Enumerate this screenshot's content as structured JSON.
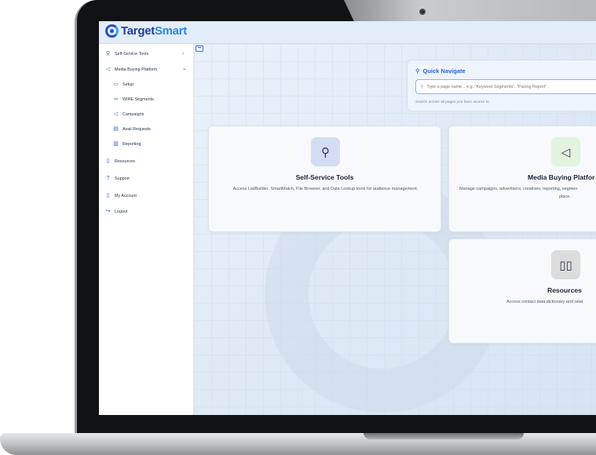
{
  "brand": {
    "name_dark": "Target",
    "name_light": "Smart"
  },
  "sidebar": {
    "items": [
      {
        "label": "Self-Service Tools",
        "icon": "user-search-icon",
        "chevron": "›"
      },
      {
        "label": "Media Buying Platform",
        "icon": "megaphone-icon",
        "chevron": "⌄"
      },
      {
        "label": "Setup",
        "icon": "setup-icon"
      },
      {
        "label": "WIRE Segments",
        "icon": "link-icon"
      },
      {
        "label": "Campaigns",
        "icon": "megaphone-icon"
      },
      {
        "label": "Avail Requests",
        "icon": "calendar-icon"
      },
      {
        "label": "Reporting",
        "icon": "report-icon"
      },
      {
        "label": "Resources",
        "icon": "book-icon"
      },
      {
        "label": "Support",
        "icon": "help-circle-icon"
      },
      {
        "label": "My Account",
        "icon": "document-icon"
      },
      {
        "label": "Logout",
        "icon": "logout-icon"
      }
    ]
  },
  "quick_navigate": {
    "title": "Quick Navigate",
    "placeholder": "Type a page name... e.g. \"Keyword Segments\", \"Pacing Report\"",
    "help": "Search across all pages you have access to"
  },
  "cards": [
    {
      "title": "Self-Service Tools",
      "description": "Access ListBuilder, SmartMatch, File Browser, and Data Lookup tools for audience management.",
      "icon": "user-search-icon",
      "icon_bg": "#d3dcf2"
    },
    {
      "title": "Media Buying Platfor",
      "description_line1": "Manage campaigns, advertisers, creatives, reporting, segmen",
      "description_line2": "place.",
      "icon": "megaphone-icon",
      "icon_bg": "#e3f3df"
    },
    {
      "title": "Resources",
      "description": "Access contact data dictionary and relat",
      "icon": "book-icon",
      "icon_bg": "#dcdcdc"
    }
  ],
  "colors": {
    "accent": "#2a63d8",
    "brand_dark": "#1e3f9e",
    "brand_light": "#2f86e6"
  }
}
